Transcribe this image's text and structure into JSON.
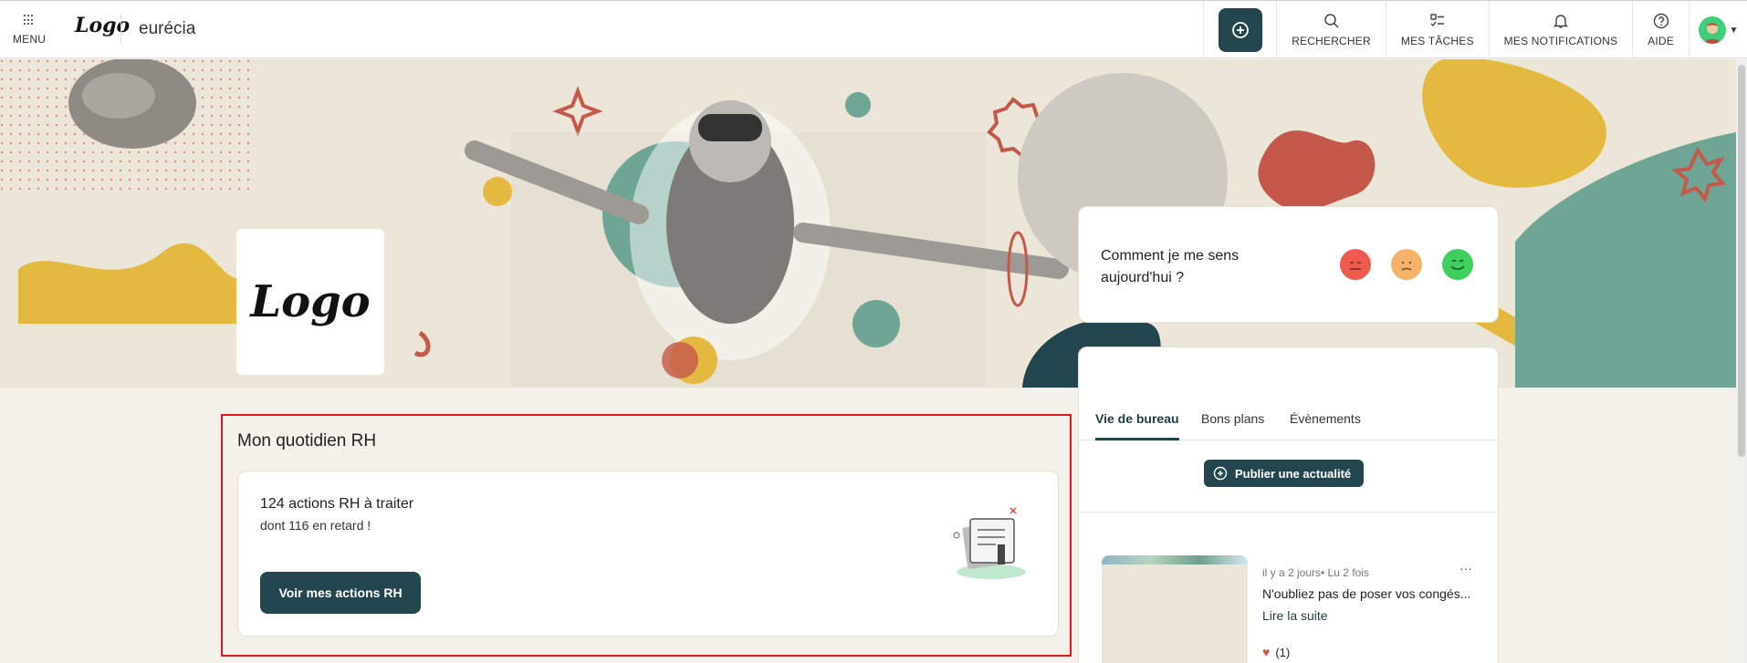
{
  "topbar": {
    "menu_label": "MENU",
    "logo_text": "Logo",
    "brand": "eurécia",
    "items": [
      {
        "label": "RECHERCHER",
        "icon": "search-icon"
      },
      {
        "label": "MES TÂCHES",
        "icon": "tasks-icon"
      },
      {
        "label": "MES NOTIFICATIONS",
        "icon": "bell-icon"
      },
      {
        "label": "AIDE",
        "icon": "help-icon"
      }
    ],
    "add_icon": "plus-circle-icon",
    "accent": "#23464e"
  },
  "hero": {
    "company_logo_text": "Logo"
  },
  "mood": {
    "question": "Comment je me sens aujourd'hui ?",
    "options": [
      {
        "icon": "sad-face-icon",
        "color": "#ef5a4f"
      },
      {
        "icon": "neutral-face-icon",
        "color": "#f4b26a"
      },
      {
        "icon": "happy-face-icon",
        "color": "#3fcf5e"
      }
    ]
  },
  "news": {
    "tabs": [
      "Vie de bureau",
      "Bons plans",
      "Évènements"
    ],
    "active_tab": "Vie de bureau",
    "publish_label": "Publier une actualité",
    "post": {
      "meta": "il y a 2 jours• Lu 2 fois",
      "title": "N'oubliez pas de poser vos congés...",
      "read_more": "Lire la suite",
      "likes": "(1)"
    }
  },
  "rh": {
    "title": "Mon quotidien RH",
    "count": "124 actions RH à traiter",
    "late": "dont 116 en retard !",
    "button": "Voir mes actions RH"
  }
}
